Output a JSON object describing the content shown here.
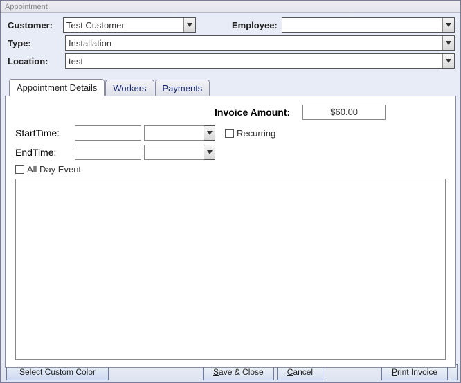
{
  "window": {
    "title": "Appointment"
  },
  "form": {
    "customer_label": "Customer:",
    "customer_value": "Test Customer",
    "employee_label": "Employee:",
    "employee_value": "",
    "type_label": "Type:",
    "type_value": "Installation",
    "location_label": "Location:",
    "location_value": "test"
  },
  "tabs": {
    "t0": "Appointment Details",
    "t1": "Workers",
    "t2": "Payments"
  },
  "details": {
    "invoice_label": "Invoice Amount:",
    "invoice_value": "$60.00",
    "start_label": "StartTime:",
    "start_time": "",
    "start_date": "",
    "end_label": "EndTime:",
    "end_time": "",
    "end_date": "",
    "recurring_label": "Recurring",
    "allday_label": "All Day Event",
    "notes": ""
  },
  "buttons": {
    "select_color": "Select Custom Color",
    "save_close": "Save & Close",
    "cancel": "Cancel",
    "print_invoice": "Print Invoice"
  }
}
